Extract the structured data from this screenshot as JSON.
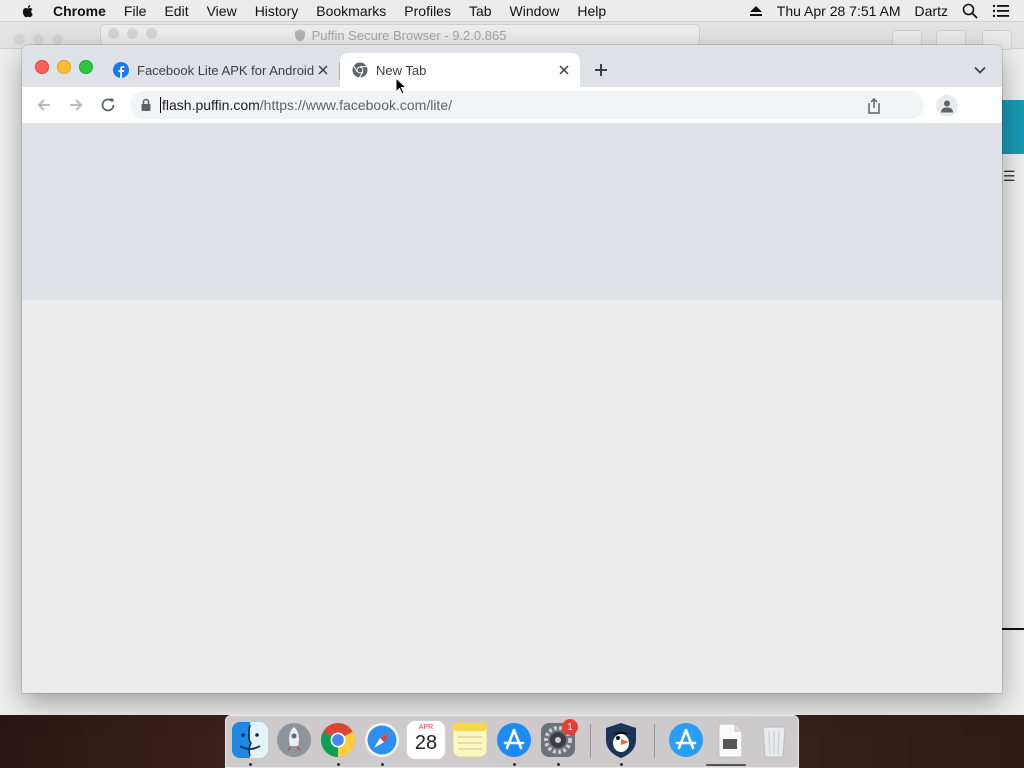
{
  "menubar": {
    "app_name": "Chrome",
    "items": [
      "File",
      "Edit",
      "View",
      "History",
      "Bookmarks",
      "Profiles",
      "Tab",
      "Window",
      "Help"
    ],
    "datetime": "Thu Apr 28  7:51 AM",
    "user": "Dartz"
  },
  "background_window": {
    "title": "Puffin Secure Browser - 9.2.0.865"
  },
  "tabs": [
    {
      "label": "Facebook Lite APK for Android",
      "icon": "facebook-icon",
      "active": false
    },
    {
      "label": "New Tab",
      "icon": "chrome-icon",
      "active": true
    }
  ],
  "omnibox": {
    "host": "flash.puffin.com",
    "path": "/https://www.facebook.com/lite/"
  },
  "dock": {
    "items": [
      "Finder",
      "Launchpad",
      "Google Chrome",
      "Safari",
      "Calendar",
      "Notes",
      "App Store",
      "System Preferences",
      "Puffin",
      "App Store",
      "Preview",
      "Trash"
    ],
    "calendar_month": "APR",
    "calendar_day": "28",
    "system_prefs_badge": "1"
  },
  "colors": {
    "accent_teal": "#1a9bb6",
    "tabstrip": "#dee1e6",
    "close_red": "#fe5f57",
    "minimize_yellow": "#febc2e",
    "zoom_green": "#28c840"
  }
}
